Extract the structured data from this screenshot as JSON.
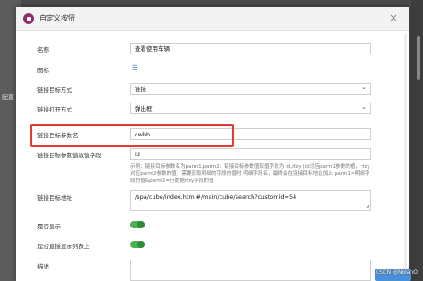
{
  "background": {
    "sidebar_label": "配置"
  },
  "dialog": {
    "title": "自定义按钮",
    "close_glyph": "×"
  },
  "form": {
    "name": {
      "label": "名称",
      "value": "查看使用车辆"
    },
    "icon": {
      "label": "图标",
      "glyph": "☰"
    },
    "link_target": {
      "label": "链接目标方式",
      "value": "链接"
    },
    "link_open": {
      "label": "链接打开方式",
      "value": "弹出框"
    },
    "param_name": {
      "label": "链接目标参数名",
      "value": "cwbh"
    },
    "param_field": {
      "label": "链接目标参数值取值字段",
      "value": "id",
      "hint": "示例：链接目标参数名为parm1,parm2，链接目标参数值取值字段为 id,rfzy (id对应parm1参数的值，rfzy对应parm2参数的值，需要获取明细的字段的值时 明细字段名，最终会在链接目标地址加上 parm1=明细字段的值&parm2=行数据rfzy字段的值"
    },
    "link_url": {
      "label": "链接目标地址",
      "value": "/spa/cube/index.html#/main/cube/search?customid=54"
    },
    "show": {
      "label": "是否显示"
    },
    "show_in_list": {
      "label": "是否直接显示列表上"
    },
    "description": {
      "label": "描述"
    }
  },
  "watermark": "CSDN @NolanO",
  "colors": {
    "highlight": "#e53935",
    "toggle_on": "#4caf50",
    "icon_blue": "#3a7bd5"
  },
  "icons": {
    "app": "app-logo-icon",
    "close": "close-icon",
    "list": "list-icon",
    "chevron": "chevron-down-icon"
  }
}
